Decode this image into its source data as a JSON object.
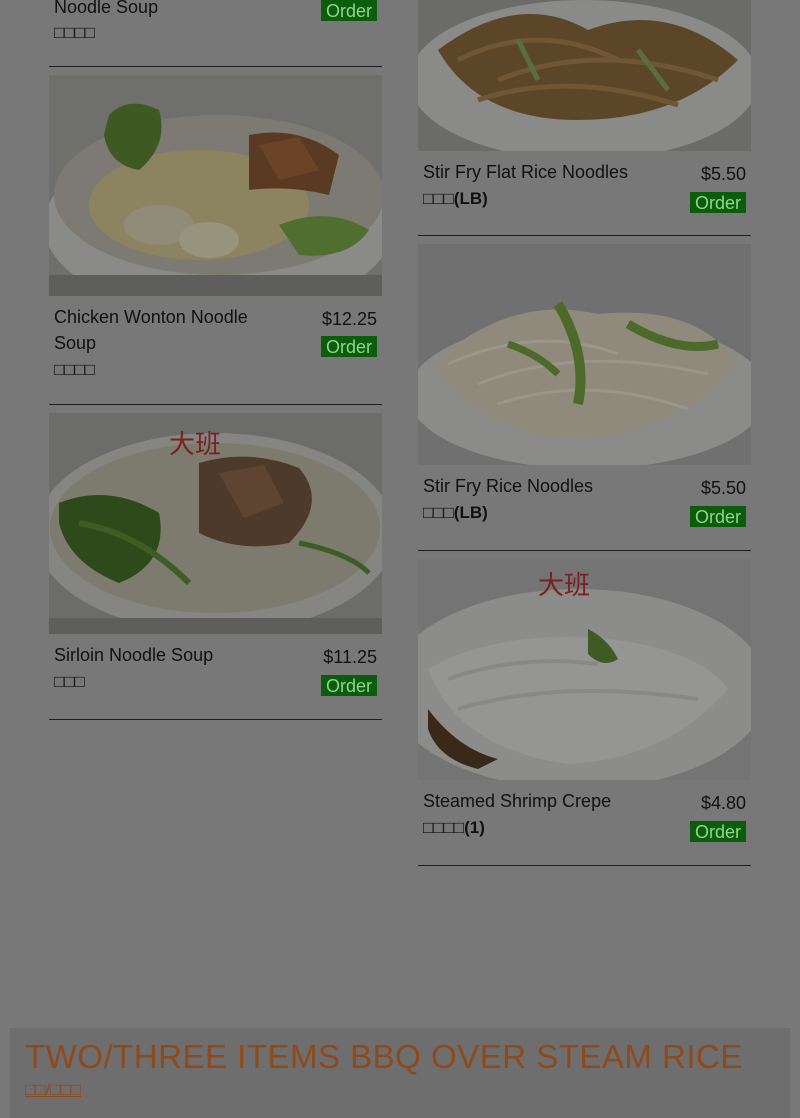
{
  "left_column": [
    {
      "name": "Noodle Soup",
      "sub": "□□□□",
      "price": "",
      "order": "Order",
      "photo": "none-cropped"
    },
    {
      "name": "Chicken Wonton Noodle Soup",
      "sub": "□□□□",
      "price": "$12.25",
      "order": "Order",
      "photo": "wonton-bowl"
    },
    {
      "name": "Sirloin Noodle Soup",
      "sub": "□□□",
      "price": "$11.25",
      "order": "Order",
      "photo": "sirloin-bowl"
    }
  ],
  "right_column": [
    {
      "name": "Stir Fry Flat Rice Noodles",
      "sub": "□□□(LB)",
      "price": "$5.50",
      "order": "Order",
      "photo": "flat-noodles-plate"
    },
    {
      "name": "Stir Fry Rice Noodles",
      "sub": "□□□(LB)",
      "price": "$5.50",
      "order": "Order",
      "photo": "rice-noodles-plate"
    },
    {
      "name": "Steamed Shrimp Crepe",
      "sub": "□□□□(1)",
      "price": "$4.80",
      "order": "Order",
      "photo": "shrimp-crepe-plate"
    }
  ],
  "section": {
    "title": "TWO/THREE ITEMS BBQ OVER STEAM RICE",
    "sub": "□□/□□□"
  },
  "colors": {
    "overlay_bg": "#787878",
    "order_bg": "#0b5d0b",
    "order_text": "#8fd48f",
    "section_title": "#8f4a1c"
  }
}
